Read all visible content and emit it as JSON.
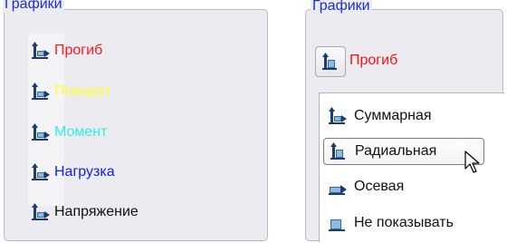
{
  "left_panel": {
    "title": "Графики",
    "items": [
      {
        "label": "Прогиб",
        "color": "#ff1a1a",
        "icon": "deflection-icon"
      },
      {
        "label": "Поворот",
        "color": "#ffff2a",
        "icon": "deflection-icon"
      },
      {
        "label": "Момент",
        "color": "#2aeeee",
        "icon": "deflection-icon"
      },
      {
        "label": "Нагрузка",
        "color": "#1520e8",
        "icon": "deflection-icon"
      },
      {
        "label": "Напряжение",
        "color": "#111111",
        "icon": "deflection-icon"
      }
    ]
  },
  "right_panel": {
    "title": "Графики",
    "combo": {
      "label": "Прогиб",
      "color": "#ff1010",
      "icon": "radial-icon"
    },
    "menu": {
      "items": [
        {
          "label": "Суммарная",
          "icon": "summary-icon"
        },
        {
          "label": "Радиальная",
          "icon": "radial-icon",
          "selected": true
        },
        {
          "label": "Осевая",
          "icon": "axial-icon"
        },
        {
          "label": "Не показывать",
          "icon": "hide-icon"
        }
      ]
    }
  }
}
